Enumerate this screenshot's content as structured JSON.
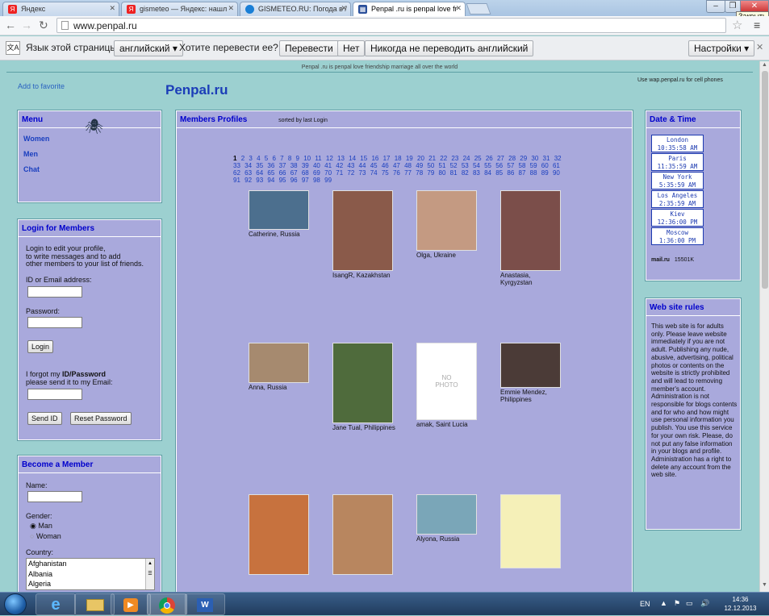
{
  "browser": {
    "tabs": [
      {
        "title": "Яндекс",
        "icon": "yandex-icon",
        "color": "#e22"
      },
      {
        "title": "gismeteo — Яндекс: нашл",
        "icon": "yandex-icon",
        "color": "#e22"
      },
      {
        "title": "GISMETEO.RU: Погода в /",
        "icon": "gismeteo-icon",
        "color": "#1a7fd6"
      },
      {
        "title": "Penpal .ru is penpal love fr",
        "icon": "grid-icon",
        "color": "#2a4f9a"
      }
    ],
    "close_tooltip": "Закрыть",
    "url": "www.penpal.ru",
    "translate": {
      "label": "Язык этой страницы",
      "language": "английский",
      "question": "Хотите перевести ее?",
      "translate_btn": "Перевести",
      "no_btn": "Нет",
      "never_btn": "Никогда не переводить английский",
      "settings_btn": "Настройки"
    }
  },
  "site": {
    "tagline": "Penpal .ru is penpal love friendship marriage all over the world",
    "add_favorite": "Add to favorite",
    "logo": "Penpal.ru",
    "wap_note": "Use wap.penpal.ru for cell phones"
  },
  "menu": {
    "title": "Menu",
    "items": [
      "Women",
      "Men",
      "Chat"
    ]
  },
  "login": {
    "title": "Login for Members",
    "intro": [
      "Login to edit your profile,",
      "to write messages and to add",
      "other members to your list of friends."
    ],
    "id_label": "ID or Email address:",
    "password_label": "Password:",
    "login_btn": "Login",
    "forgot_text_1": "I forgot my ",
    "forgot_bold": "ID/Password",
    "forgot_text_2": "please send it to my Email:",
    "send_id_btn": "Send ID",
    "reset_btn": "Reset Password"
  },
  "signup": {
    "title": "Become a Member",
    "name_label": "Name:",
    "gender_label": "Gender:",
    "gender_man": "Man",
    "gender_woman": "Woman",
    "country_label": "Country:",
    "countries": [
      "Afghanistan",
      "Albania",
      "Algeria"
    ]
  },
  "members": {
    "title": "Members Profiles",
    "sorted": "sorted by last Login",
    "current_page": "1",
    "pages": [
      "1",
      "2",
      "3",
      "4",
      "5",
      "6",
      "7",
      "8",
      "9",
      "10",
      "11",
      "12",
      "13",
      "14",
      "15",
      "16",
      "17",
      "18",
      "19",
      "20",
      "21",
      "22",
      "23",
      "24",
      "25",
      "26",
      "27",
      "28",
      "29",
      "30",
      "31",
      "32",
      "33",
      "34",
      "35",
      "36",
      "37",
      "38",
      "39",
      "40",
      "41",
      "42",
      "43",
      "44",
      "45",
      "46",
      "47",
      "48",
      "49",
      "50",
      "51",
      "52",
      "53",
      "54",
      "55",
      "56",
      "57",
      "58",
      "59",
      "60",
      "61",
      "62",
      "63",
      "64",
      "65",
      "66",
      "67",
      "68",
      "69",
      "70",
      "71",
      "72",
      "73",
      "74",
      "75",
      "76",
      "77",
      "78",
      "79",
      "80",
      "81",
      "82",
      "83",
      "84",
      "85",
      "86",
      "87",
      "88",
      "89",
      "90",
      "91",
      "92",
      "93",
      "94",
      "95",
      "96",
      "97",
      "98",
      "99"
    ],
    "profiles": [
      {
        "name": "Catherine, Russia",
        "color": "#4c6f8e"
      },
      {
        "name": "IsangR, Kazakhstan",
        "color": "#8a5a4a"
      },
      {
        "name": "Olga, Ukraine",
        "color": "#c49a82"
      },
      {
        "name": "Anastasia, Kyrgyzstan",
        "color": "#7b4e4a"
      },
      {
        "name": "Anna, Russia",
        "color": "#a68a6f"
      },
      {
        "name": "Jane Tual, Philippines",
        "color": "#4f6b3c"
      },
      {
        "name": "amak, Saint Lucia",
        "color": "#ffffff",
        "nophoto": "NO PHOTO"
      },
      {
        "name": "Emmie Mendez, Philippines",
        "color": "#4b3b37"
      },
      {
        "name": "",
        "color": "#c7723e"
      },
      {
        "name": "",
        "color": "#b8865f"
      },
      {
        "name": "Alyona, Russia",
        "color": "#7aa6b8"
      },
      {
        "name": "",
        "color": "#f5f0b8"
      }
    ]
  },
  "datetime": {
    "title": "Date & Time",
    "clocks": [
      {
        "city": "London",
        "time": "10:35:58 AM"
      },
      {
        "city": "Paris",
        "time": "11:35:59 AM"
      },
      {
        "city": "New York",
        "time": "5:35:59 AM"
      },
      {
        "city": "Los Angeles",
        "time": "2:35:59 AM"
      },
      {
        "city": "Kiev",
        "time": "12:36:00 PM"
      },
      {
        "city": "Moscow",
        "time": "1:36:00 PM"
      }
    ],
    "counter_logo": "mail.ru",
    "counter_value": "15501K"
  },
  "rules": {
    "title": "Web site rules",
    "text": "This web site is for adults only. Please leave website immediately if you are not adult. Publishing any nude, abusive, advertising, political photos or contents on the website is strictly prohibited and will lead to removing member's account. Administration is not responsible for blogs contents and for who and how might use personal information you publish. You use this service for your own risk. Please, do not put any false information in your blogs and profile. Administration has a right to delete any account from the web site."
  },
  "taskbar": {
    "lang": "EN",
    "time": "14:36",
    "date": "12.12.2013"
  }
}
